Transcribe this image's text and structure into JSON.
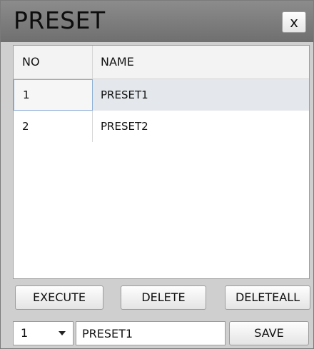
{
  "window": {
    "title": "PRESET",
    "close_label": "x"
  },
  "grid": {
    "columns": [
      "NO",
      "NAME"
    ],
    "rows": [
      {
        "no": "1",
        "name": "PRESET1"
      },
      {
        "no": "2",
        "name": "PRESET2"
      }
    ]
  },
  "buttons": {
    "execute": "EXECUTE",
    "delete": "DELETE",
    "delete_all": "DELETEALL",
    "save": "SAVE"
  },
  "footer": {
    "selected_no": "1",
    "name_value": "PRESET1"
  }
}
